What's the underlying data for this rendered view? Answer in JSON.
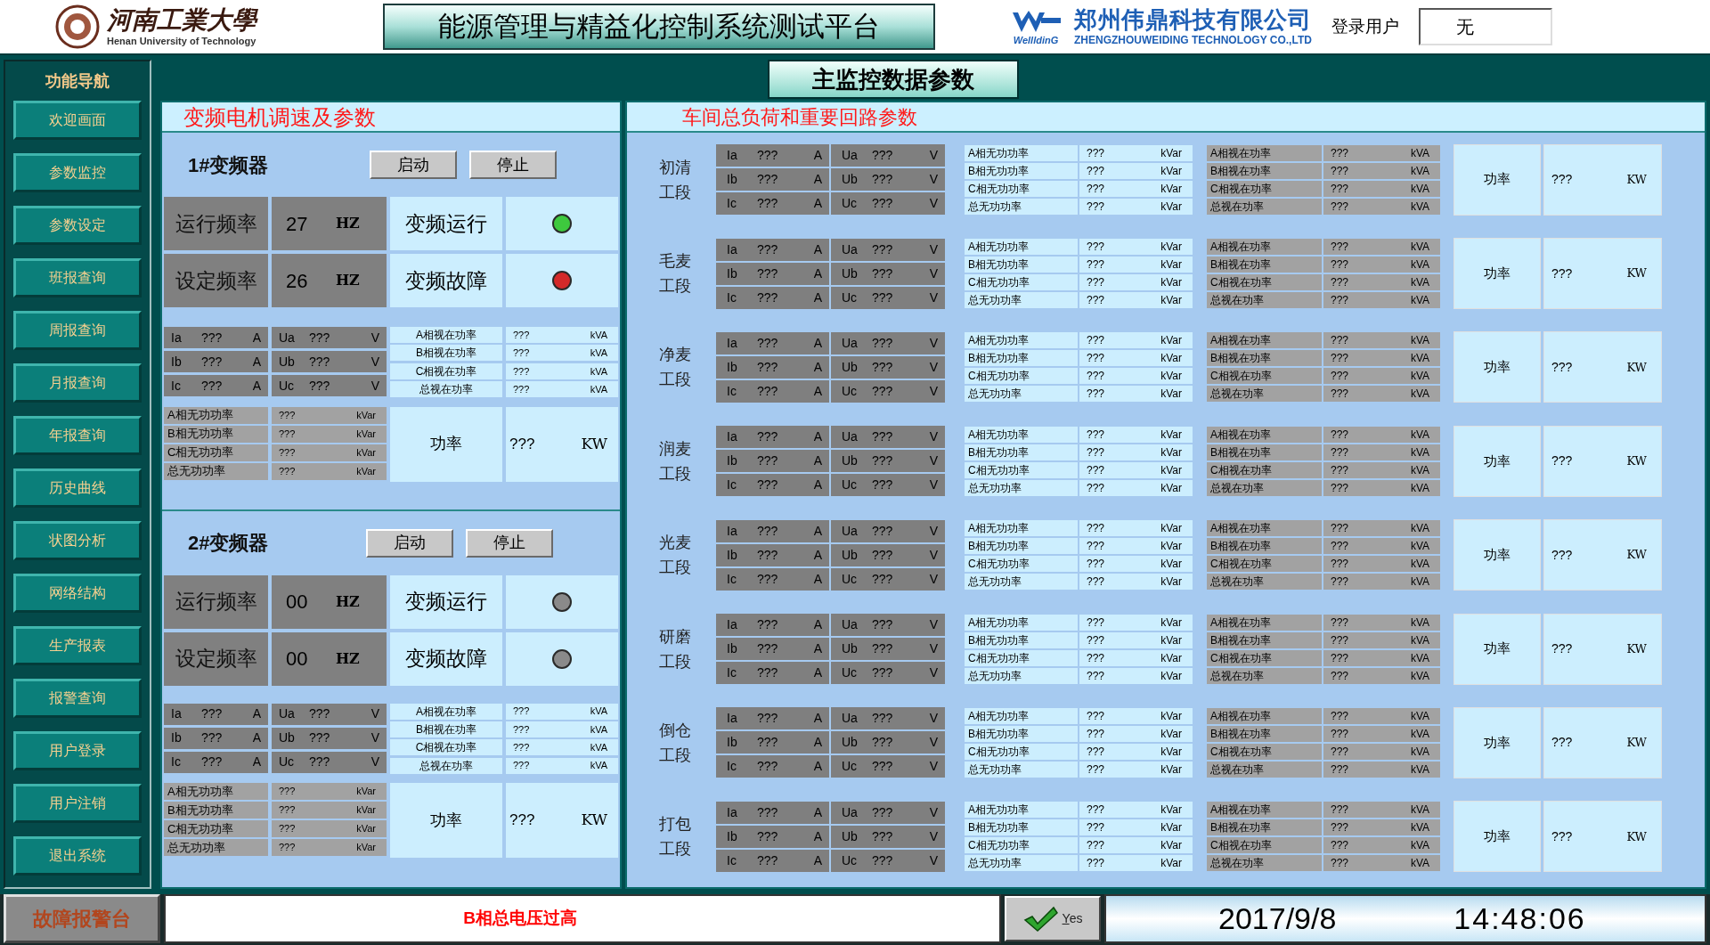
{
  "header": {
    "university": {
      "name": "河南工業大學",
      "english": "Henan University of Technology"
    },
    "title": "能源管理与精益化控制系统测试平台",
    "company": {
      "logo_text": "WellldinG",
      "name": "郑州伟鼎科技有限公司",
      "english": "ZHENGZHOUWEIDING TECHNOLOGY CO.,LTD"
    },
    "login": {
      "label": "登录用户",
      "value": "无"
    }
  },
  "nav": {
    "title": "功能导航",
    "items": [
      "欢迎画面",
      "参数监控",
      "参数设定",
      "班报查询",
      "周报查询",
      "月报查询",
      "年报查询",
      "历史曲线",
      "状图分析",
      "网络结构",
      "生产报表",
      "报警查询",
      "用户登录",
      "用户注销",
      "退出系统"
    ]
  },
  "main_title": "主监控数据参数",
  "drive_panel": {
    "title": "变频电机调速及参数",
    "drives": [
      {
        "name": "1#变频器",
        "buttons": [
          "启动",
          "停止"
        ],
        "rows": [
          {
            "label": "运行频率",
            "value": "27",
            "unit": "HZ",
            "status": "变频运行",
            "on": true
          },
          {
            "label": "设定频率",
            "value": "26",
            "unit": "HZ",
            "status": "变频故障",
            "on": true
          }
        ],
        "currents": [
          {
            "label": "Ia",
            "value": "???",
            "unit": "A"
          },
          {
            "label": "Ib",
            "value": "???",
            "unit": "A"
          },
          {
            "label": "Ic",
            "value": "???",
            "unit": "A"
          }
        ],
        "voltages": [
          {
            "label": "Ua",
            "value": "???",
            "unit": "V"
          },
          {
            "label": "Ub",
            "value": "???",
            "unit": "V"
          },
          {
            "label": "Uc",
            "value": "???",
            "unit": "V"
          }
        ],
        "apparent": [
          {
            "label": "A相视在功率",
            "value": "???",
            "unit": "kVA"
          },
          {
            "label": "B相视在功率",
            "value": "???",
            "unit": "kVA"
          },
          {
            "label": "C相视在功率",
            "value": "???",
            "unit": "kVA"
          },
          {
            "label": "总视在功率",
            "value": "???",
            "unit": "kVA"
          }
        ],
        "reactive": [
          {
            "label": "A相无功功率",
            "value": "???",
            "unit": "kVar"
          },
          {
            "label": "B相无功功率",
            "value": "???",
            "unit": "kVar"
          },
          {
            "label": "C相无功功率",
            "value": "???",
            "unit": "kVar"
          },
          {
            "label": "总无功功率",
            "value": "???",
            "unit": "kVar"
          }
        ],
        "power": {
          "label": "功率",
          "value": "???",
          "unit": "KW"
        }
      },
      {
        "name": "2#变频器",
        "buttons": [
          "启动",
          "停止"
        ],
        "rows": [
          {
            "label": "运行频率",
            "value": "00",
            "unit": "HZ",
            "status": "变频运行",
            "on": false
          },
          {
            "label": "设定频率",
            "value": "00",
            "unit": "HZ",
            "status": "变频故障",
            "on": false
          }
        ],
        "currents": [
          {
            "label": "Ia",
            "value": "???",
            "unit": "A"
          },
          {
            "label": "Ib",
            "value": "???",
            "unit": "A"
          },
          {
            "label": "Ic",
            "value": "???",
            "unit": "A"
          }
        ],
        "voltages": [
          {
            "label": "Ua",
            "value": "???",
            "unit": "V"
          },
          {
            "label": "Ub",
            "value": "???",
            "unit": "V"
          },
          {
            "label": "Uc",
            "value": "???",
            "unit": "V"
          }
        ],
        "apparent": [
          {
            "label": "A相视在功率",
            "value": "???",
            "unit": "kVA"
          },
          {
            "label": "B相视在功率",
            "value": "???",
            "unit": "kVA"
          },
          {
            "label": "C相视在功率",
            "value": "???",
            "unit": "kVA"
          },
          {
            "label": "总视在功率",
            "value": "???",
            "unit": "kVA"
          }
        ],
        "reactive": [
          {
            "label": "A相无功功率",
            "value": "???",
            "unit": "kVar"
          },
          {
            "label": "B相无功功率",
            "value": "???",
            "unit": "kVar"
          },
          {
            "label": "C相无功功率",
            "value": "???",
            "unit": "kVar"
          },
          {
            "label": "总无功功率",
            "value": "???",
            "unit": "kVar"
          }
        ],
        "power": {
          "label": "功率",
          "value": "???",
          "unit": "KW"
        }
      }
    ]
  },
  "workshop_panel": {
    "title": "车间总负荷和重要回路参数",
    "sections": [
      {
        "name": [
          "初清",
          "工段"
        ],
        "currents": [
          {
            "label": "Ia",
            "value": "???",
            "unit": "A"
          },
          {
            "label": "Ib",
            "value": "???",
            "unit": "A"
          },
          {
            "label": "Ic",
            "value": "???",
            "unit": "A"
          }
        ],
        "voltages": [
          {
            "label": "Ua",
            "value": "???",
            "unit": "V"
          },
          {
            "label": "Ub",
            "value": "???",
            "unit": "V"
          },
          {
            "label": "Uc",
            "value": "???",
            "unit": "V"
          }
        ],
        "reactive": [
          {
            "label": "A相无功功率",
            "value": "???",
            "unit": "kVar"
          },
          {
            "label": "B相无功功率",
            "value": "???",
            "unit": "kVar"
          },
          {
            "label": "C相无功功率",
            "value": "???",
            "unit": "kVar"
          },
          {
            "label": "总无功功率",
            "value": "???",
            "unit": "kVar"
          }
        ],
        "apparent": [
          {
            "label": "A相视在功率",
            "value": "???",
            "unit": "kVA"
          },
          {
            "label": "B相视在功率",
            "value": "???",
            "unit": "kVA"
          },
          {
            "label": "C相视在功率",
            "value": "???",
            "unit": "kVA"
          },
          {
            "label": "总视在功率",
            "value": "???",
            "unit": "kVA"
          }
        ],
        "power": {
          "label": "功率",
          "value": "???",
          "unit": "KW"
        }
      },
      {
        "name": [
          "毛麦",
          "工段"
        ],
        "currents": [
          {
            "label": "Ia",
            "value": "???",
            "unit": "A"
          },
          {
            "label": "Ib",
            "value": "???",
            "unit": "A"
          },
          {
            "label": "Ic",
            "value": "???",
            "unit": "A"
          }
        ],
        "voltages": [
          {
            "label": "Ua",
            "value": "???",
            "unit": "V"
          },
          {
            "label": "Ub",
            "value": "???",
            "unit": "V"
          },
          {
            "label": "Uc",
            "value": "???",
            "unit": "V"
          }
        ],
        "reactive": [
          {
            "label": "A相无功功率",
            "value": "???",
            "unit": "kVar"
          },
          {
            "label": "B相无功功率",
            "value": "???",
            "unit": "kVar"
          },
          {
            "label": "C相无功功率",
            "value": "???",
            "unit": "kVar"
          },
          {
            "label": "总无功功率",
            "value": "???",
            "unit": "kVar"
          }
        ],
        "apparent": [
          {
            "label": "A相视在功率",
            "value": "???",
            "unit": "kVA"
          },
          {
            "label": "B相视在功率",
            "value": "???",
            "unit": "kVA"
          },
          {
            "label": "C相视在功率",
            "value": "???",
            "unit": "kVA"
          },
          {
            "label": "总视在功率",
            "value": "???",
            "unit": "kVA"
          }
        ],
        "power": {
          "label": "功率",
          "value": "???",
          "unit": "KW"
        }
      },
      {
        "name": [
          "净麦",
          "工段"
        ],
        "currents": [
          {
            "label": "Ia",
            "value": "???",
            "unit": "A"
          },
          {
            "label": "Ib",
            "value": "???",
            "unit": "A"
          },
          {
            "label": "Ic",
            "value": "???",
            "unit": "A"
          }
        ],
        "voltages": [
          {
            "label": "Ua",
            "value": "???",
            "unit": "V"
          },
          {
            "label": "Ub",
            "value": "???",
            "unit": "V"
          },
          {
            "label": "Uc",
            "value": "???",
            "unit": "V"
          }
        ],
        "reactive": [
          {
            "label": "A相无功功率",
            "value": "???",
            "unit": "kVar"
          },
          {
            "label": "B相无功功率",
            "value": "???",
            "unit": "kVar"
          },
          {
            "label": "C相无功功率",
            "value": "???",
            "unit": "kVar"
          },
          {
            "label": "总无功功率",
            "value": "???",
            "unit": "kVar"
          }
        ],
        "apparent": [
          {
            "label": "A相视在功率",
            "value": "???",
            "unit": "kVA"
          },
          {
            "label": "B相视在功率",
            "value": "???",
            "unit": "kVA"
          },
          {
            "label": "C相视在功率",
            "value": "???",
            "unit": "kVA"
          },
          {
            "label": "总视在功率",
            "value": "???",
            "unit": "kVA"
          }
        ],
        "power": {
          "label": "功率",
          "value": "???",
          "unit": "KW"
        }
      },
      {
        "name": [
          "润麦",
          "工段"
        ],
        "currents": [
          {
            "label": "Ia",
            "value": "???",
            "unit": "A"
          },
          {
            "label": "Ib",
            "value": "???",
            "unit": "A"
          },
          {
            "label": "Ic",
            "value": "???",
            "unit": "A"
          }
        ],
        "voltages": [
          {
            "label": "Ua",
            "value": "???",
            "unit": "V"
          },
          {
            "label": "Ub",
            "value": "???",
            "unit": "V"
          },
          {
            "label": "Uc",
            "value": "???",
            "unit": "V"
          }
        ],
        "reactive": [
          {
            "label": "A相无功功率",
            "value": "???",
            "unit": "kVar"
          },
          {
            "label": "B相无功功率",
            "value": "???",
            "unit": "kVar"
          },
          {
            "label": "C相无功功率",
            "value": "???",
            "unit": "kVar"
          },
          {
            "label": "总无功功率",
            "value": "???",
            "unit": "kVar"
          }
        ],
        "apparent": [
          {
            "label": "A相视在功率",
            "value": "???",
            "unit": "kVA"
          },
          {
            "label": "B相视在功率",
            "value": "???",
            "unit": "kVA"
          },
          {
            "label": "C相视在功率",
            "value": "???",
            "unit": "kVA"
          },
          {
            "label": "总视在功率",
            "value": "???",
            "unit": "kVA"
          }
        ],
        "power": {
          "label": "功率",
          "value": "???",
          "unit": "KW"
        }
      },
      {
        "name": [
          "光麦",
          "工段"
        ],
        "currents": [
          {
            "label": "Ia",
            "value": "???",
            "unit": "A"
          },
          {
            "label": "Ib",
            "value": "???",
            "unit": "A"
          },
          {
            "label": "Ic",
            "value": "???",
            "unit": "A"
          }
        ],
        "voltages": [
          {
            "label": "Ua",
            "value": "???",
            "unit": "V"
          },
          {
            "label": "Ub",
            "value": "???",
            "unit": "V"
          },
          {
            "label": "Uc",
            "value": "???",
            "unit": "V"
          }
        ],
        "reactive": [
          {
            "label": "A相无功功率",
            "value": "???",
            "unit": "kVar"
          },
          {
            "label": "B相无功功率",
            "value": "???",
            "unit": "kVar"
          },
          {
            "label": "C相无功功率",
            "value": "???",
            "unit": "kVar"
          },
          {
            "label": "总无功功率",
            "value": "???",
            "unit": "kVar"
          }
        ],
        "apparent": [
          {
            "label": "A相视在功率",
            "value": "???",
            "unit": "kVA"
          },
          {
            "label": "B相视在功率",
            "value": "???",
            "unit": "kVA"
          },
          {
            "label": "C相视在功率",
            "value": "???",
            "unit": "kVA"
          },
          {
            "label": "总视在功率",
            "value": "???",
            "unit": "kVA"
          }
        ],
        "power": {
          "label": "功率",
          "value": "???",
          "unit": "KW"
        }
      },
      {
        "name": [
          "研磨",
          "工段"
        ],
        "currents": [
          {
            "label": "Ia",
            "value": "???",
            "unit": "A"
          },
          {
            "label": "Ib",
            "value": "???",
            "unit": "A"
          },
          {
            "label": "Ic",
            "value": "???",
            "unit": "A"
          }
        ],
        "voltages": [
          {
            "label": "Ua",
            "value": "???",
            "unit": "V"
          },
          {
            "label": "Ub",
            "value": "???",
            "unit": "V"
          },
          {
            "label": "Uc",
            "value": "???",
            "unit": "V"
          }
        ],
        "reactive": [
          {
            "label": "A相无功功率",
            "value": "???",
            "unit": "kVar"
          },
          {
            "label": "B相无功功率",
            "value": "???",
            "unit": "kVar"
          },
          {
            "label": "C相无功功率",
            "value": "???",
            "unit": "kVar"
          },
          {
            "label": "总无功功率",
            "value": "???",
            "unit": "kVar"
          }
        ],
        "apparent": [
          {
            "label": "A相视在功率",
            "value": "???",
            "unit": "kVA"
          },
          {
            "label": "B相视在功率",
            "value": "???",
            "unit": "kVA"
          },
          {
            "label": "C相视在功率",
            "value": "???",
            "unit": "kVA"
          },
          {
            "label": "总视在功率",
            "value": "???",
            "unit": "kVA"
          }
        ],
        "power": {
          "label": "功率",
          "value": "???",
          "unit": "KW"
        }
      },
      {
        "name": [
          "倒仓",
          "工段"
        ],
        "currents": [
          {
            "label": "Ia",
            "value": "???",
            "unit": "A"
          },
          {
            "label": "Ib",
            "value": "???",
            "unit": "A"
          },
          {
            "label": "Ic",
            "value": "???",
            "unit": "A"
          }
        ],
        "voltages": [
          {
            "label": "Ua",
            "value": "???",
            "unit": "V"
          },
          {
            "label": "Ub",
            "value": "???",
            "unit": "V"
          },
          {
            "label": "Uc",
            "value": "???",
            "unit": "V"
          }
        ],
        "reactive": [
          {
            "label": "A相无功功率",
            "value": "???",
            "unit": "kVar"
          },
          {
            "label": "B相无功功率",
            "value": "???",
            "unit": "kVar"
          },
          {
            "label": "C相无功功率",
            "value": "???",
            "unit": "kVar"
          },
          {
            "label": "总无功功率",
            "value": "???",
            "unit": "kVar"
          }
        ],
        "apparent": [
          {
            "label": "A相视在功率",
            "value": "???",
            "unit": "kVA"
          },
          {
            "label": "B相视在功率",
            "value": "???",
            "unit": "kVA"
          },
          {
            "label": "C相视在功率",
            "value": "???",
            "unit": "kVA"
          },
          {
            "label": "总视在功率",
            "value": "???",
            "unit": "kVA"
          }
        ],
        "power": {
          "label": "功率",
          "value": "???",
          "unit": "KW"
        }
      },
      {
        "name": [
          "打包",
          "工段"
        ],
        "currents": [
          {
            "label": "Ia",
            "value": "???",
            "unit": "A"
          },
          {
            "label": "Ib",
            "value": "???",
            "unit": "A"
          },
          {
            "label": "Ic",
            "value": "???",
            "unit": "A"
          }
        ],
        "voltages": [
          {
            "label": "Ua",
            "value": "???",
            "unit": "V"
          },
          {
            "label": "Ub",
            "value": "???",
            "unit": "V"
          },
          {
            "label": "Uc",
            "value": "???",
            "unit": "V"
          }
        ],
        "reactive": [
          {
            "label": "A相无功功率",
            "value": "???",
            "unit": "kVar"
          },
          {
            "label": "B相无功功率",
            "value": "???",
            "unit": "kVar"
          },
          {
            "label": "C相无功功率",
            "value": "???",
            "unit": "kVar"
          },
          {
            "label": "总无功功率",
            "value": "???",
            "unit": "kVar"
          }
        ],
        "apparent": [
          {
            "label": "A相视在功率",
            "value": "???",
            "unit": "kVA"
          },
          {
            "label": "B相视在功率",
            "value": "???",
            "unit": "kVA"
          },
          {
            "label": "C相视在功率",
            "value": "???",
            "unit": "kVA"
          },
          {
            "label": "总视在功率",
            "value": "???",
            "unit": "kVA"
          }
        ],
        "power": {
          "label": "功率",
          "value": "???",
          "unit": "KW"
        }
      }
    ]
  },
  "status_bar": {
    "alarm_button": "故障报警台",
    "message": "B相总电压过高",
    "confirm_button": "Yes",
    "date": "2017/9/8",
    "time": "14:48:06"
  }
}
